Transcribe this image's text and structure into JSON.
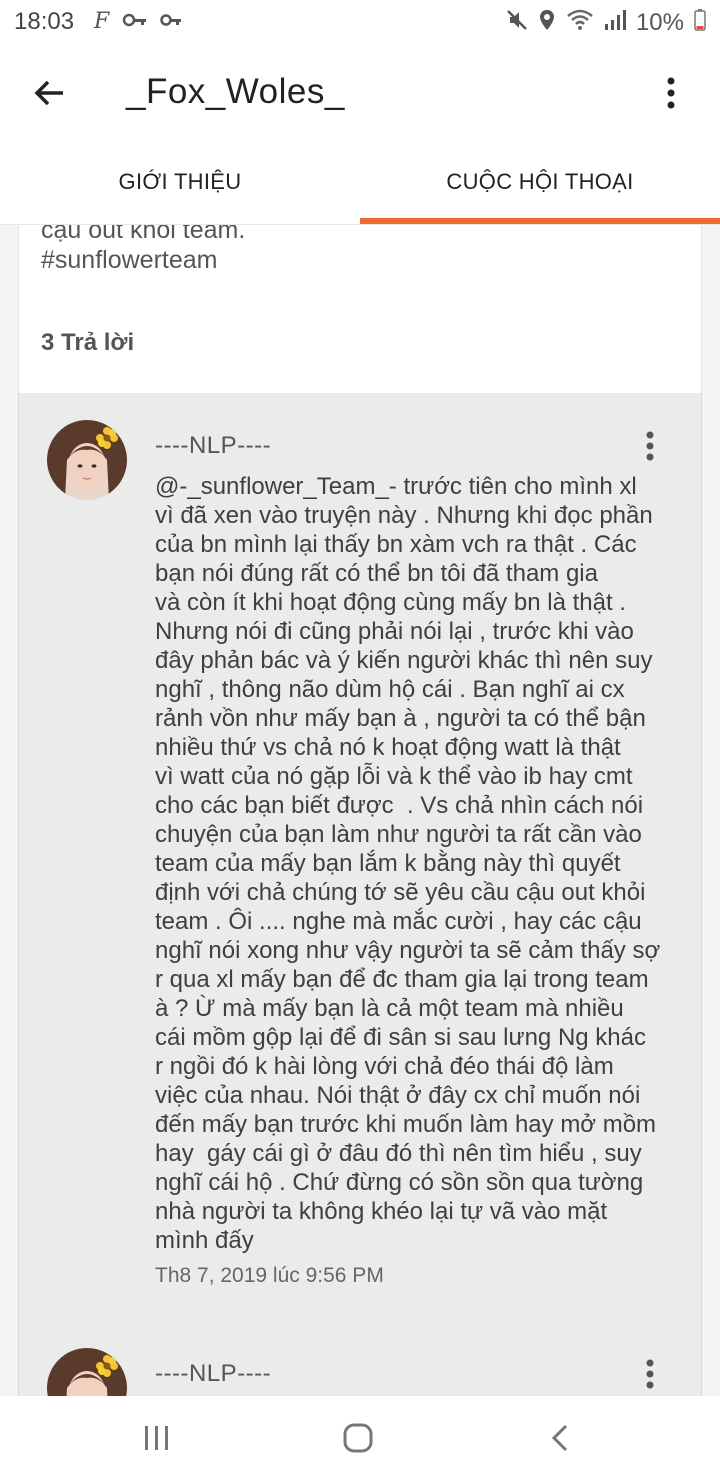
{
  "status_bar": {
    "time": "18:03",
    "battery": "10%",
    "left_icons": [
      "facebook-f-icon",
      "key-icon",
      "key-icon"
    ],
    "right_icons": [
      "mute-icon",
      "location-icon",
      "wifi-icon",
      "signal-icon",
      "battery-low-icon"
    ]
  },
  "app_bar": {
    "title": "_Fox_Woles_",
    "back_icon": "arrow-left-icon",
    "menu_icon": "more-vertical-icon"
  },
  "tabs": [
    {
      "label": "GIỚI THIỆU",
      "active": false
    },
    {
      "label": "CUỘC HỘI THOẠI",
      "active": true
    }
  ],
  "accent_color": "#ec6b2d",
  "post": {
    "tail_text": "cậu out khỏi team.\n#sunflowerteam",
    "reply_count": "3 Trả lời"
  },
  "replies": [
    {
      "author": "----NLP----",
      "lines": [
        "@-_sunflower_Team_- trước tiên cho mình xl",
        "vì đã xen vào truyện này . Nhưng khi đọc phần",
        "của bn mình lại thấy bn xàm vch ra thật . Các",
        "bạn nói đúng rất có thể bn tôi đã tham gia",
        "và còn ít khi hoạt động cùng mấy bn là thật .",
        "Nhưng nói đi cũng phải nói lại , trước khi vào",
        "đây phản bác và ý kiến người khác thì nên suy",
        "nghĩ , thông não dùm hộ cái . Bạn nghĩ ai cx",
        "rảnh vồn như mấy bạn à , người ta có thể bận",
        "nhiều thứ vs chả nó k hoạt động watt là thật",
        "vì watt của nó gặp lỗi và k thể vào ib hay cmt",
        "cho các bạn biết được  . Vs chả nhìn cách nói",
        "chuyện của bạn làm như người ta rất cần vào",
        "team của mấy bạn lắm k bằng này thì quyết",
        "định với chả chúng tớ sẽ yêu cầu cậu out khỏi",
        "team . Ôi .... nghe mà mắc cười , hay các cậu",
        "nghĩ nói xong như vậy người ta sẽ cảm thấy sợ",
        "r qua xl mấy bạn để đc tham gia lại trong team",
        "à ? Ừ mà mấy bạn là cả một team mà nhiều",
        "cái mồm gộp lại để đi sân si sau lưng Ng khác",
        "r ngồi đó k hài lòng với chả đéo thái độ làm",
        "việc của nhau. Nói thật ở đây cx chỉ muốn nói",
        "đến mấy bạn trước khi muốn làm hay mở mồm",
        "hay  gáy cái gì ở đâu đó thì nên tìm hiểu , suy",
        "nghĩ cái hộ . Chứ đừng có sồn sồn qua tường",
        "nhà người ta không khéo lại tự vã vào mặt",
        "mình đấy"
      ],
      "timestamp": "Th8 7, 2019 lúc 9:56 PM"
    },
    {
      "author": "----NLP----",
      "lines": [],
      "timestamp": ""
    }
  ],
  "nav_bar": {
    "icons": [
      "recent-apps-icon",
      "home-icon",
      "back-icon"
    ]
  }
}
